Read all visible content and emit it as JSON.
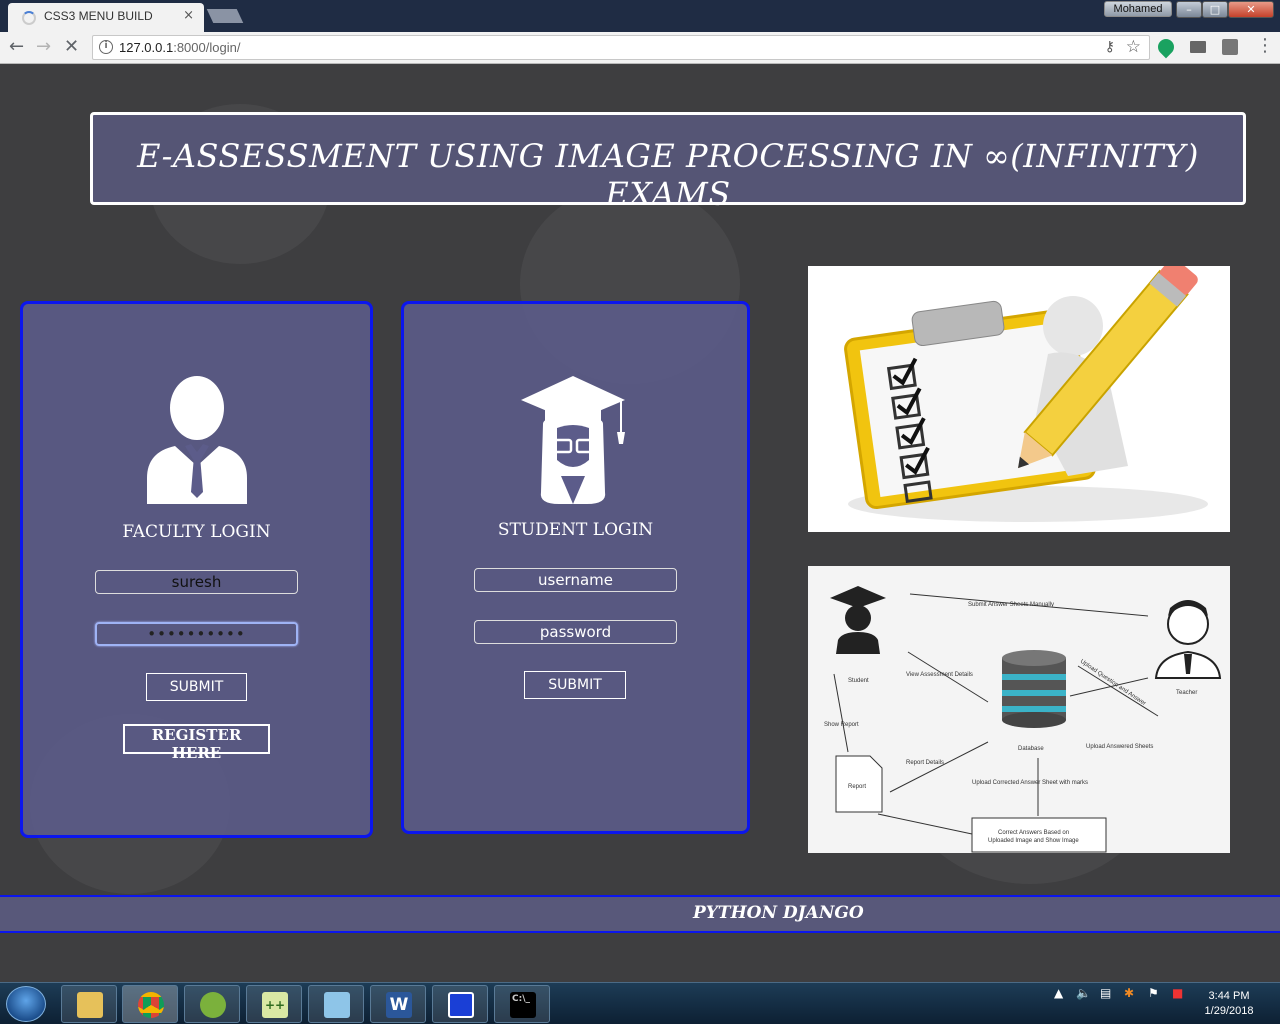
{
  "browser": {
    "tab_title": "CSS3 MENU BUILD",
    "tab_close": "×",
    "profile_name": "Mohamed",
    "url_host": "127.0.0.1",
    "url_rest": ":8000/login/"
  },
  "header": {
    "title": "E-ASSESSMENT USING IMAGE PROCESSING IN ∞(INFINITY) EXAMS"
  },
  "faculty": {
    "heading": "FACULTY LOGIN",
    "username_value": "suresh",
    "password_value": "password12",
    "submit_label": "SUBMIT",
    "register_label": "REGISTER HERE"
  },
  "student": {
    "heading": "STUDENT LOGIN",
    "username_placeholder": "username",
    "password_placeholder": "password",
    "submit_label": "SUBMIT"
  },
  "diagram": {
    "student": "Student",
    "teacher": "Teacher",
    "database": "Database",
    "report": "Report",
    "submit_sheets": "Submit Answer Sheets Manually",
    "view_assessment": "View Assessment Details",
    "upload_qa": "Upload Question and Answer",
    "upload_answered": "Upload Answered Sheets",
    "show_report": "Show Report",
    "report_details": "Report Details",
    "upload_corrected": "Upload Corrected Answer Sheet with marks",
    "correct_answers_1": "Correct Answers Based on",
    "correct_answers_2": "Uploaded Image and Show Image"
  },
  "footer": {
    "text": "PYTHON DJANGO"
  },
  "taskbar": {
    "time": "3:44 PM",
    "date": "1/29/2018"
  }
}
